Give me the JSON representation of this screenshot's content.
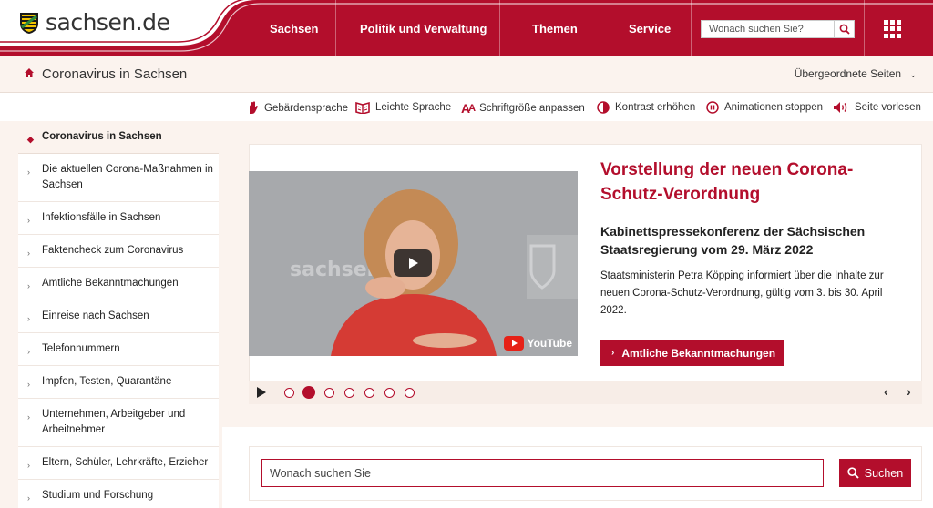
{
  "header": {
    "logo_text": "sachsen.de",
    "nav": [
      "Sachsen",
      "Politik und Verwaltung",
      "Themen",
      "Service"
    ],
    "search_placeholder": "Wonach suchen Sie?"
  },
  "section": {
    "title": "Coronavirus in Sachsen",
    "parent_pages": "Übergeordnete Seiten"
  },
  "accessibility": [
    {
      "icon": "sign-language-icon",
      "label": "Gebärdensprache"
    },
    {
      "icon": "easy-read-icon",
      "label": "Leichte Sprache"
    },
    {
      "icon": "font-size-icon",
      "label": "Schriftgröße anpassen"
    },
    {
      "icon": "contrast-icon",
      "label": "Kontrast erhöhen"
    },
    {
      "icon": "pause-icon",
      "label": "Animationen stoppen"
    },
    {
      "icon": "speaker-icon",
      "label": "Seite vorlesen"
    }
  ],
  "sidebar": {
    "items": [
      {
        "label": "Coronavirus in Sachsen"
      },
      {
        "label": "Die aktuellen Corona-Maßnahmen in Sachsen"
      },
      {
        "label": "Infektionsfälle in Sachsen"
      },
      {
        "label": "Faktencheck zum Coronavirus"
      },
      {
        "label": "Amtliche Bekanntmachungen"
      },
      {
        "label": "Einreise nach Sachsen"
      },
      {
        "label": "Telefonnummern"
      },
      {
        "label": "Impfen, Testen, Quarantäne"
      },
      {
        "label": "Unternehmen, Arbeitgeber und Arbeitnehmer"
      },
      {
        "label": "Eltern, Schüler, Lehrkräfte, Erzieher"
      },
      {
        "label": "Studium und Forschung"
      }
    ]
  },
  "slide": {
    "title": "Vorstellung der neuen Corona-Schutz-Verordnung",
    "subtitle": "Kabinettspressekonferenz der Sächsischen Staatsregierung vom 29. März 2022",
    "description": "Staatsministerin Petra Köpping informiert über die Inhalte zur neuen Corona-Schutz-Verordnung, gültig vom 3. bis 30. April 2022.",
    "cta": "Amtliche Bekanntmachungen",
    "video_brand": "sachsen",
    "youtube_label": "YouTube",
    "dots": 7,
    "active_dot": 1
  },
  "search": {
    "placeholder": "Wonach suchen Sie",
    "button": "Suchen"
  },
  "colors": {
    "brand_red": "#b30e2c",
    "cream": "#fbf3ee"
  }
}
